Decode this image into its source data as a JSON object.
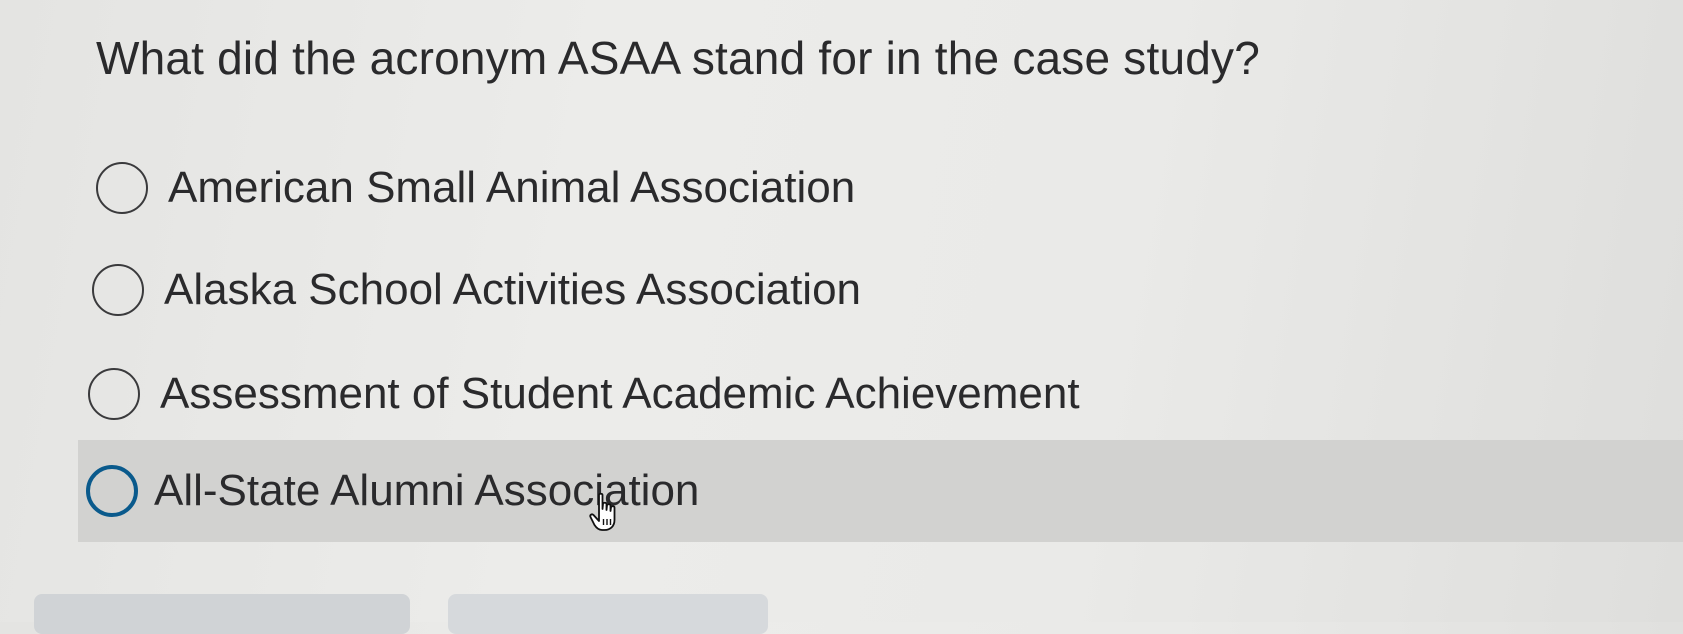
{
  "question": {
    "text": "What did the acronym ASAA stand for in the case study?"
  },
  "options": [
    {
      "label": "American Small Animal Association",
      "selected": false
    },
    {
      "label": "Alaska School Activities Association",
      "selected": false
    },
    {
      "label": "Assessment of Student Academic Achievement",
      "selected": false
    },
    {
      "label": "All-State Alumni Association",
      "selected": false,
      "hovered": true
    }
  ],
  "colors": {
    "text": "#2a2a2c",
    "hover_background": "#d2d2d0",
    "focus_ring": "#0a5a8c",
    "page_background": "#e8e8e6"
  },
  "icons": {
    "radio": "radio-circle-icon",
    "cursor": "hand-pointer-cursor-icon"
  }
}
